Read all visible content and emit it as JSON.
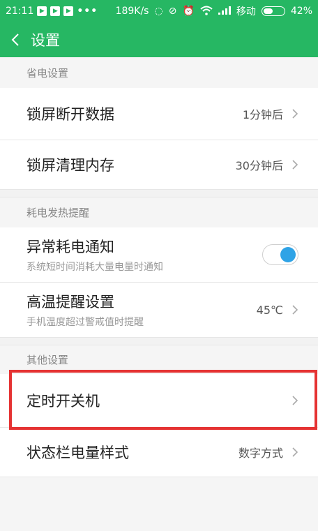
{
  "status_bar": {
    "time": "21:11",
    "speed": "189K/s",
    "carrier": "移动",
    "battery_pct": "42%",
    "battery_level": 0.42,
    "icons": [
      "play-icon",
      "play-icon",
      "play-icon",
      "more-dots-icon",
      "sync-icon",
      "vibrate-off-icon",
      "alarm-icon",
      "wifi-icon",
      "signal-icon",
      "battery-icon"
    ]
  },
  "header": {
    "title": "设置",
    "back_icon": "chevron-left-icon"
  },
  "sections": [
    {
      "header": "省电设置",
      "rows": [
        {
          "title": "锁屏断开数据",
          "value": "1分钟后"
        },
        {
          "title": "锁屏清理内存",
          "value": "30分钟后"
        }
      ]
    },
    {
      "header": "耗电发热提醒",
      "rows": [
        {
          "title": "异常耗电通知",
          "subtitle": "系统短时间消耗大量电量时通知",
          "toggle": true
        },
        {
          "title": "高温提醒设置",
          "subtitle": "手机温度超过警戒值时提醒",
          "value": "45℃"
        }
      ]
    },
    {
      "header": "其他设置",
      "rows": [
        {
          "title": "定时开关机",
          "value": ""
        },
        {
          "title": "状态栏电量样式",
          "value": "数字方式"
        }
      ]
    }
  ],
  "colors": {
    "primary": "#26b763",
    "toggle_on": "#2fa3e6",
    "highlight": "#e53333",
    "background": "#f5f5f5"
  }
}
